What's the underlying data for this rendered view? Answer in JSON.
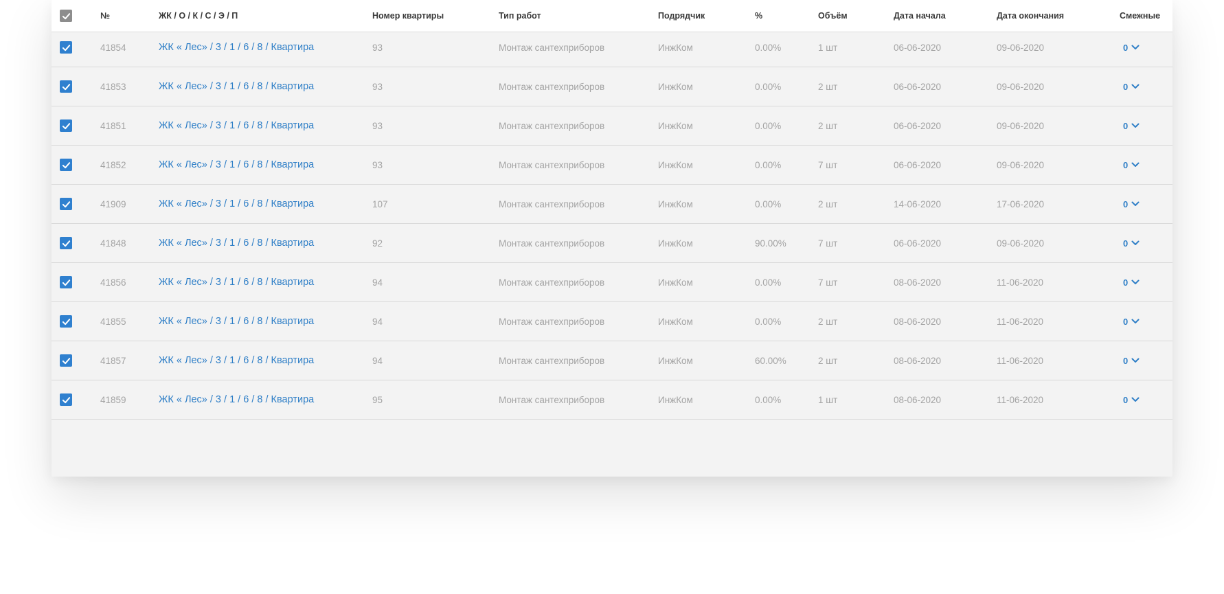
{
  "colors": {
    "accent": "#2f80cf",
    "link": "#2f7fc7",
    "muted_text": "#a3a3a3",
    "header_text": "#3a3a3a"
  },
  "table": {
    "columns": {
      "num": "№",
      "path": "ЖК / О / К / С / Э / П",
      "flat": "Номер квартиры",
      "type": "Тип работ",
      "contractor": "Подрядчик",
      "percent": "%",
      "volume": "Объём",
      "start": "Дата начала",
      "end": "Дата окончания",
      "adjacent": "Смежные"
    },
    "header_checked": true,
    "rows": [
      {
        "checked": true,
        "num": "41854",
        "path": "ЖК « Лес» / 3 / 1 / 6 / 8 / Квартира",
        "flat": "93",
        "type": "Монтаж сантехприборов",
        "contractor": "ИнжКом",
        "percent": "0.00%",
        "volume": "1 шт",
        "start": "06-06-2020",
        "end": "09-06-2020",
        "adjacent": "0"
      },
      {
        "checked": true,
        "num": "41853",
        "path": "ЖК « Лес» / 3 / 1 / 6 / 8 / Квартира",
        "flat": "93",
        "type": "Монтаж сантехприборов",
        "contractor": "ИнжКом",
        "percent": "0.00%",
        "volume": "2 шт",
        "start": "06-06-2020",
        "end": "09-06-2020",
        "adjacent": "0"
      },
      {
        "checked": true,
        "num": "41851",
        "path": "ЖК « Лес» / 3 / 1 / 6 / 8 / Квартира",
        "flat": "93",
        "type": "Монтаж сантехприборов",
        "contractor": "ИнжКом",
        "percent": "0.00%",
        "volume": "2 шт",
        "start": "06-06-2020",
        "end": "09-06-2020",
        "adjacent": "0"
      },
      {
        "checked": true,
        "num": "41852",
        "path": "ЖК « Лес» / 3 / 1 / 6 / 8 / Квартира",
        "flat": "93",
        "type": "Монтаж сантехприборов",
        "contractor": "ИнжКом",
        "percent": "0.00%",
        "volume": "7 шт",
        "start": "06-06-2020",
        "end": "09-06-2020",
        "adjacent": "0"
      },
      {
        "checked": true,
        "num": "41909",
        "path": "ЖК « Лес» / 3 / 1 / 6 / 8 / Квартира",
        "flat": "107",
        "type": "Монтаж сантехприборов",
        "contractor": "ИнжКом",
        "percent": "0.00%",
        "volume": "2 шт",
        "start": "14-06-2020",
        "end": "17-06-2020",
        "adjacent": "0"
      },
      {
        "checked": true,
        "num": "41848",
        "path": "ЖК « Лес» / 3 / 1 / 6 / 8 / Квартира",
        "flat": "92",
        "type": "Монтаж сантехприборов",
        "contractor": "ИнжКом",
        "percent": "90.00%",
        "volume": "7 шт",
        "start": "06-06-2020",
        "end": "09-06-2020",
        "adjacent": "0"
      },
      {
        "checked": true,
        "num": "41856",
        "path": "ЖК « Лес» / 3 / 1 / 6 / 8 / Квартира",
        "flat": "94",
        "type": "Монтаж сантехприборов",
        "contractor": "ИнжКом",
        "percent": "0.00%",
        "volume": "7 шт",
        "start": "08-06-2020",
        "end": "11-06-2020",
        "adjacent": "0"
      },
      {
        "checked": true,
        "num": "41855",
        "path": "ЖК « Лес» / 3 / 1 / 6 / 8 / Квартира",
        "flat": "94",
        "type": "Монтаж сантехприборов",
        "contractor": "ИнжКом",
        "percent": "0.00%",
        "volume": "2 шт",
        "start": "08-06-2020",
        "end": "11-06-2020",
        "adjacent": "0"
      },
      {
        "checked": true,
        "num": "41857",
        "path": "ЖК « Лес» / 3 / 1 / 6 / 8 / Квартира",
        "flat": "94",
        "type": "Монтаж сантехприборов",
        "contractor": "ИнжКом",
        "percent": "60.00%",
        "volume": "2 шт",
        "start": "08-06-2020",
        "end": "11-06-2020",
        "adjacent": "0"
      },
      {
        "checked": true,
        "num": "41859",
        "path": "ЖК « Лес» / 3 / 1 / 6 / 8 / Квартира",
        "flat": "95",
        "type": "Монтаж сантехприборов",
        "contractor": "ИнжКом",
        "percent": "0.00%",
        "volume": "1 шт",
        "start": "08-06-2020",
        "end": "11-06-2020",
        "adjacent": "0"
      }
    ]
  }
}
